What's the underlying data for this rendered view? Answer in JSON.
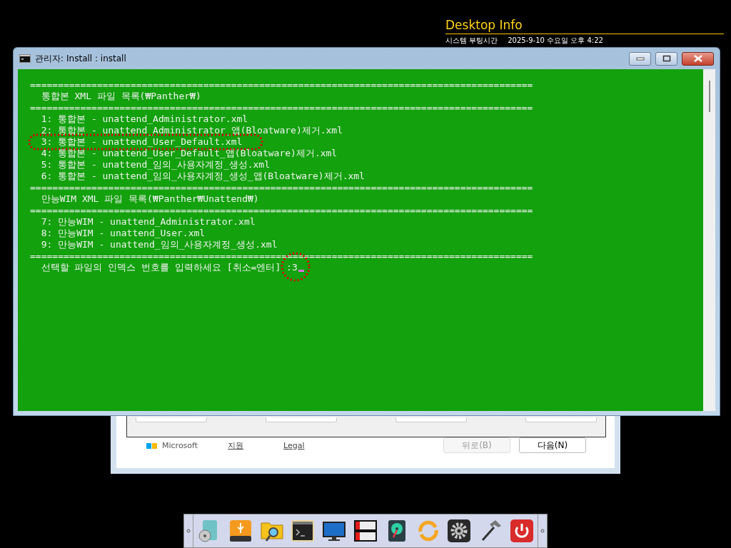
{
  "desktop_info": {
    "title": "Desktop Info",
    "boot_label": "시스템 부팅시간",
    "boot_time": "2025-9-10 수요일 오후 4:22"
  },
  "background_window": {
    "links": [
      "Microsoft",
      "지원",
      "Legal"
    ],
    "buttons": [
      {
        "label": "뒤로(B)",
        "disabled": true
      },
      {
        "label": "다음(N)",
        "disabled": false
      }
    ]
  },
  "console": {
    "title_prefix": "관리자:",
    "title": "Install : install",
    "lines": [
      {
        "kind": "separator",
        "text": "=========================================================================================="
      },
      {
        "kind": "text",
        "text": "  통합본 XML 파일 목록(₩Panther₩)",
        "annotated": false
      },
      {
        "kind": "separator",
        "text": "=========================================================================================="
      },
      {
        "kind": "text",
        "text": "  1: 통합본 - unattend_Administrator.xml",
        "annotated": false
      },
      {
        "kind": "text",
        "text": "  2: 통합본 - unattend_Administrator_앱(Bloatware)제거.xml",
        "annotated": false
      },
      {
        "kind": "text",
        "text": "  3: 통합본 - unattend_User_Default.xml",
        "annotated": true
      },
      {
        "kind": "text",
        "text": "  4: 통합본 - unattend_User_Default_앱(Bloatware)제거.xml",
        "annotated": false
      },
      {
        "kind": "text",
        "text": "  5: 통합본 - unattend_임의_사용자계정_생성.xml",
        "annotated": false
      },
      {
        "kind": "text",
        "text": "  6: 통합본 - unattend_임의_사용자계정_생성_앱(Bloatware)제거.xml",
        "annotated": false
      },
      {
        "kind": "separator",
        "text": "=========================================================================================="
      },
      {
        "kind": "text",
        "text": "  만능WIM XML 파일 목록(₩Panther₩Unattend₩)",
        "annotated": false
      },
      {
        "kind": "separator",
        "text": "=========================================================================================="
      },
      {
        "kind": "text",
        "text": "  7: 만능WIM - unattend_Administrator.xml",
        "annotated": false
      },
      {
        "kind": "text",
        "text": "  8: 만능WIM - unattend_User.xml",
        "annotated": false
      },
      {
        "kind": "text",
        "text": "  9: 만능WIM - unattend_임의_사용자계정_생성.xml",
        "annotated": false
      },
      {
        "kind": "separator",
        "text": "=========================================================================================="
      },
      {
        "kind": "prompt",
        "text": "  선택할 파일의 인덱스 번호를 입력하세요 [취소=엔터] ",
        "input": ":3",
        "annotated": true
      }
    ]
  },
  "taskbar": {
    "icons": [
      {
        "kind": "disc"
      },
      {
        "kind": "usb"
      },
      {
        "kind": "folder-search"
      },
      {
        "kind": "terminal"
      },
      {
        "kind": "monitor"
      },
      {
        "kind": "drives"
      },
      {
        "kind": "hdd"
      },
      {
        "kind": "sync"
      },
      {
        "kind": "gear"
      },
      {
        "kind": "hammer"
      },
      {
        "kind": "power"
      }
    ]
  }
}
